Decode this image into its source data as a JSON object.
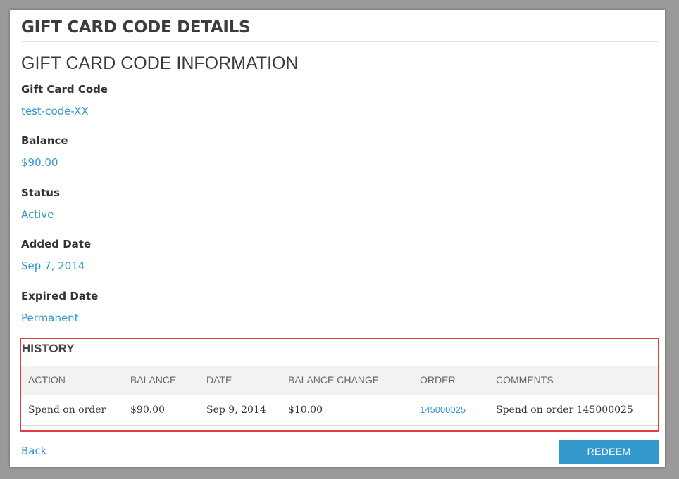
{
  "page": {
    "title": "GIFT CARD CODE DETAILS",
    "section_title": "GIFT CARD CODE INFORMATION"
  },
  "fields": [
    {
      "label": "Gift Card Code",
      "value": "test-code-XX"
    },
    {
      "label": "Balance",
      "value": "$90.00"
    },
    {
      "label": "Status",
      "value": "Active"
    },
    {
      "label": "Added Date",
      "value": "Sep 7, 2014"
    },
    {
      "label": "Expired Date",
      "value": "Permanent"
    }
  ],
  "history": {
    "title": "HISTORY",
    "columns": [
      "ACTION",
      "BALANCE",
      "DATE",
      "BALANCE CHANGE",
      "ORDER",
      "COMMENTS"
    ],
    "rows": [
      {
        "action": "Spend on order",
        "balance": "$90.00",
        "date": "Sep 9, 2014",
        "balance_change": "$10.00",
        "order": "145000025",
        "comments": "Spend on order 145000025"
      }
    ]
  },
  "actions": {
    "back_label": "Back",
    "redeem_label": "REDEEM"
  },
  "colors": {
    "accent": "#3399cc",
    "highlight_border": "#e04040",
    "table_header_bg": "#f2f2f2"
  }
}
